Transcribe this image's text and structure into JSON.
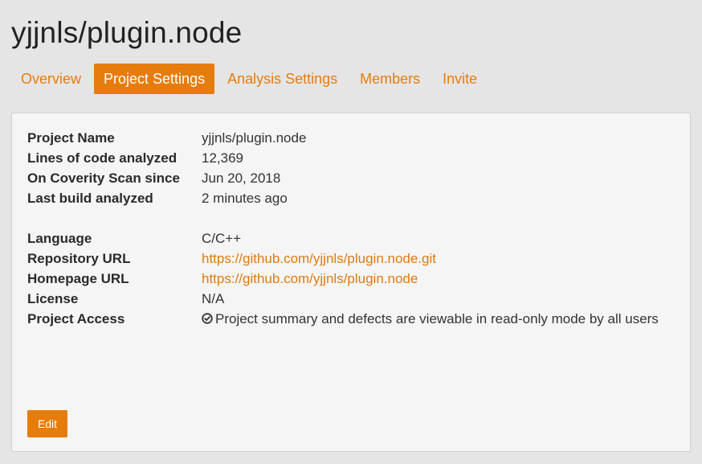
{
  "page": {
    "title": "yjjnls/plugin.node"
  },
  "tabs": [
    {
      "label": "Overview",
      "active": false
    },
    {
      "label": "Project Settings",
      "active": true
    },
    {
      "label": "Analysis Settings",
      "active": false
    },
    {
      "label": "Members",
      "active": false
    },
    {
      "label": "Invite",
      "active": false
    }
  ],
  "info": {
    "project_name": {
      "label": "Project Name",
      "value": "yjjnls/plugin.node"
    },
    "lines_of_code": {
      "label": "Lines of code analyzed",
      "value": "12,369"
    },
    "scan_since": {
      "label": "On Coverity Scan since",
      "value": "Jun 20, 2018"
    },
    "last_build": {
      "label": "Last build analyzed",
      "value": "2 minutes ago"
    },
    "language": {
      "label": "Language",
      "value": "C/C++"
    },
    "repository_url": {
      "label": "Repository URL",
      "value": "https://github.com/yjjnls/plugin.node.git"
    },
    "homepage_url": {
      "label": "Homepage URL",
      "value": "https://github.com/yjjnls/plugin.node"
    },
    "license": {
      "label": "License",
      "value": "N/A"
    },
    "project_access": {
      "label": "Project Access",
      "value": "Project summary and defects are viewable in read-only mode by all users",
      "icon": "check-circle-icon"
    }
  },
  "actions": {
    "edit_label": "Edit"
  },
  "colors": {
    "accent": "#e67c0c",
    "link": "#e07a10",
    "background": "#e5e5e5",
    "panel": "#f5f5f5"
  }
}
